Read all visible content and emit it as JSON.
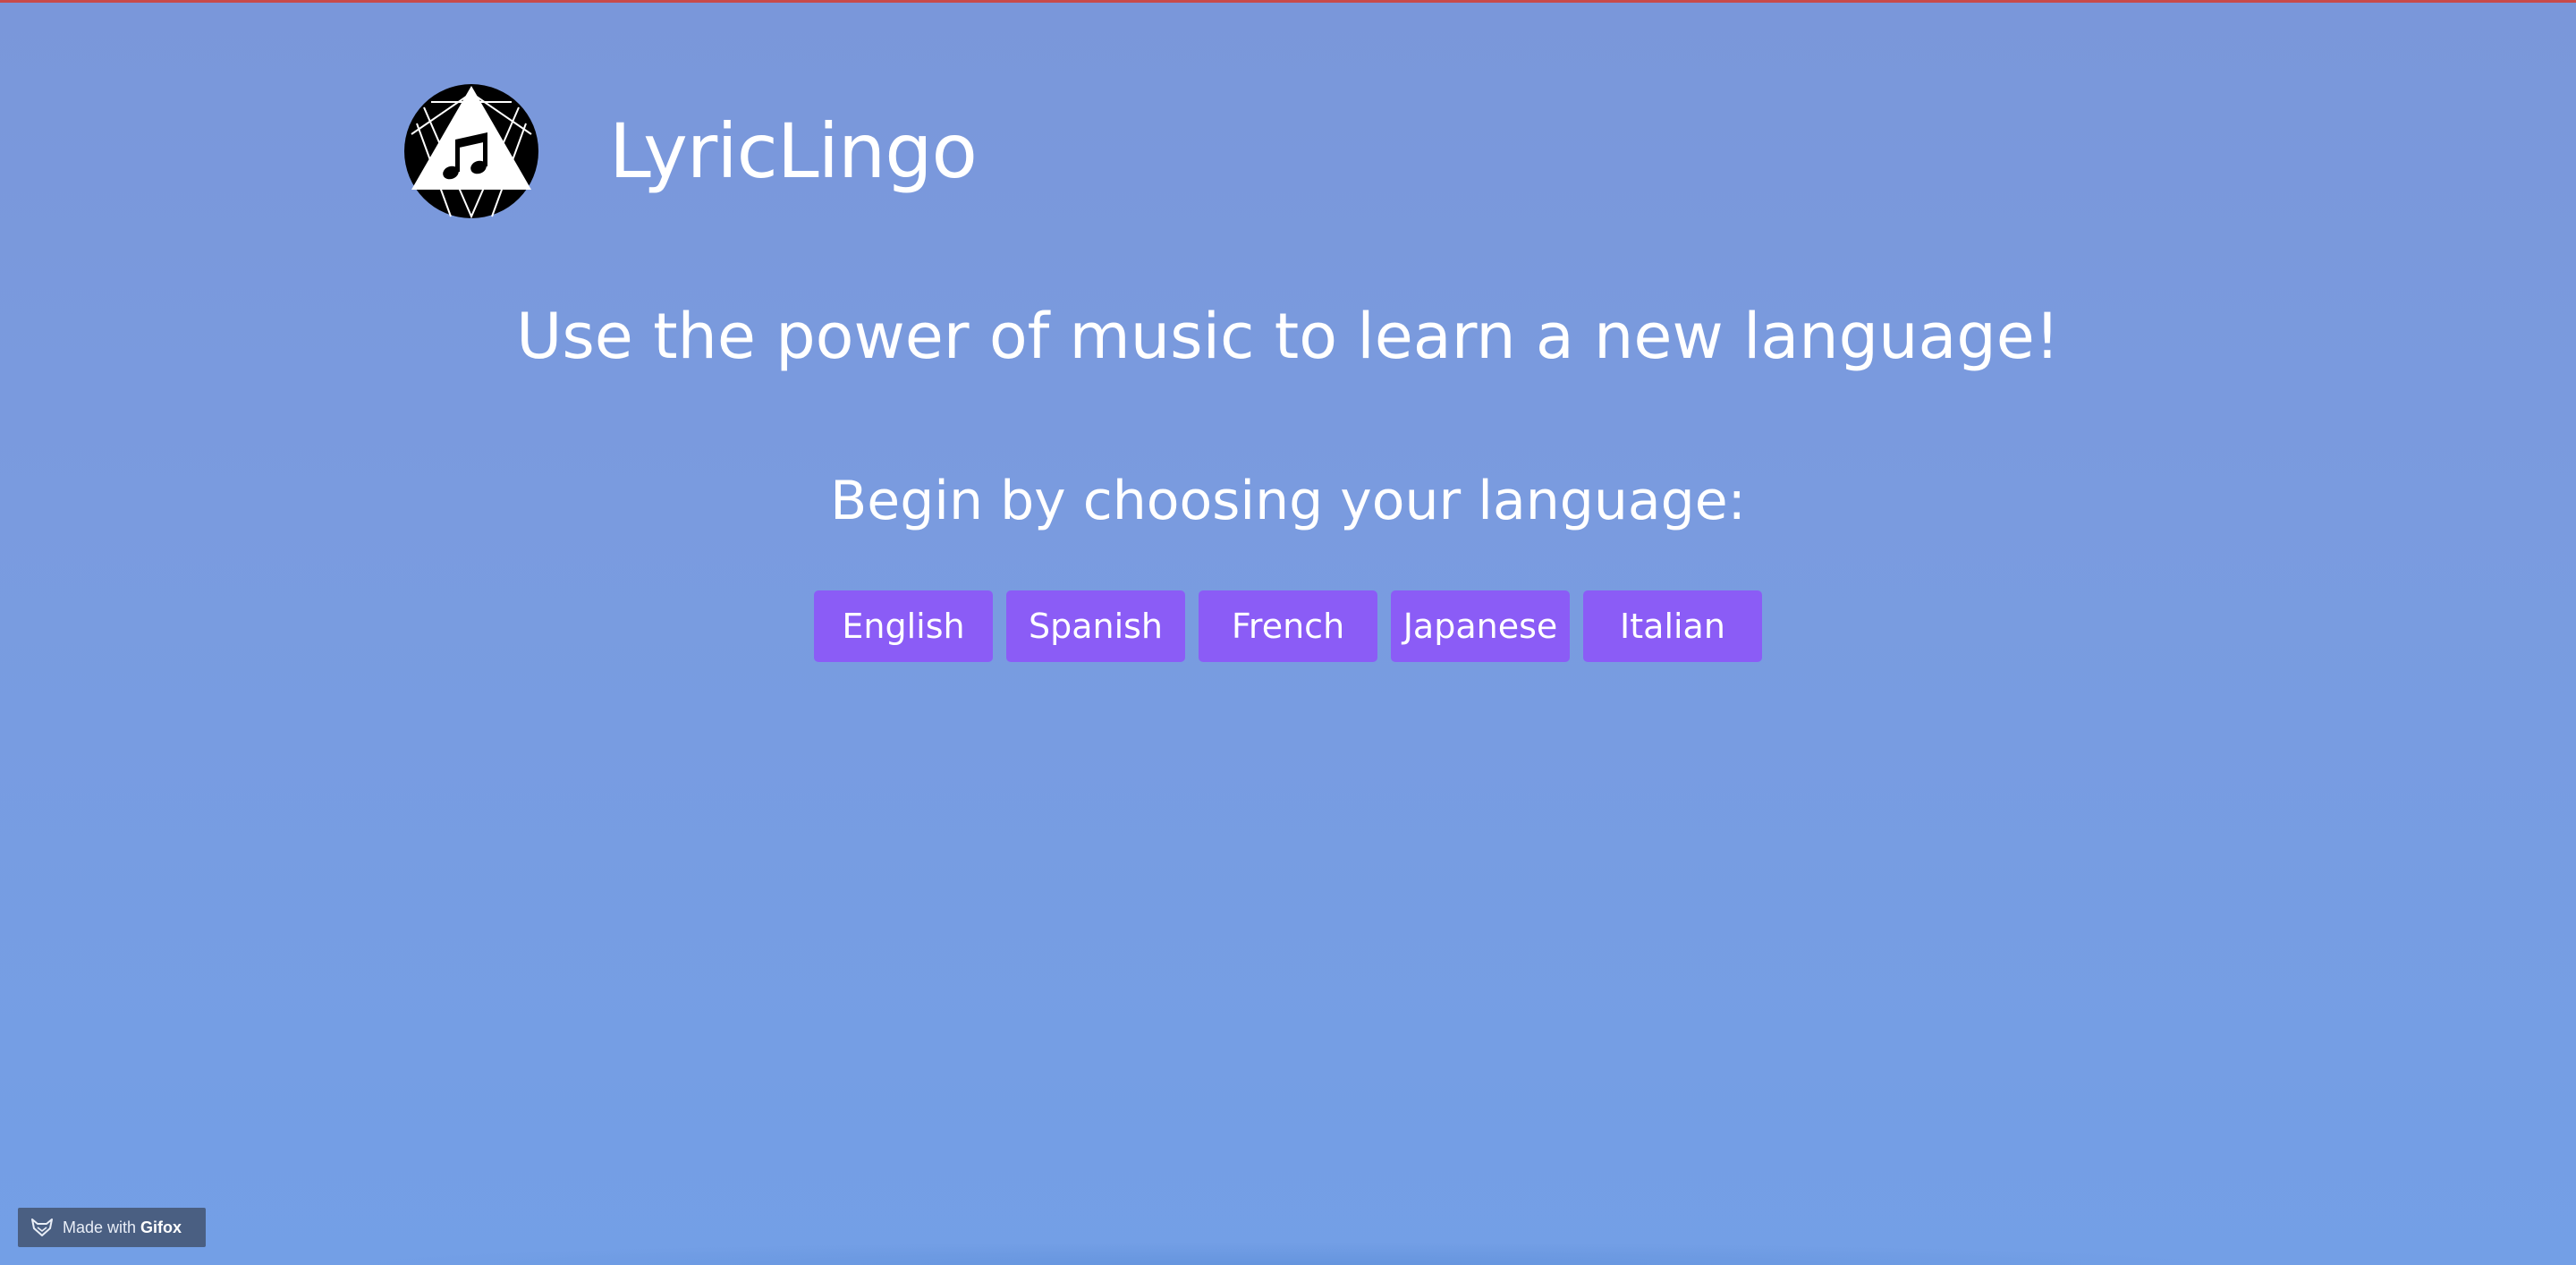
{
  "header": {
    "title": "LyricLingo",
    "logo_icon": "music-note-triangle-icon"
  },
  "main": {
    "tagline": "Use the power of music to learn a new language!",
    "prompt": "Begin by choosing your language:"
  },
  "languages": [
    {
      "label": "English"
    },
    {
      "label": "Spanish"
    },
    {
      "label": "French"
    },
    {
      "label": "Japanese"
    },
    {
      "label": "Italian"
    }
  ],
  "badge": {
    "text": "Made with",
    "brand": "Gifox",
    "icon": "fox-icon"
  },
  "colors": {
    "background": "#7a9bdf",
    "button": "#8b5cf6",
    "text": "#ffffff",
    "top_border": "#c84a4a",
    "badge": "#4a5f82"
  }
}
